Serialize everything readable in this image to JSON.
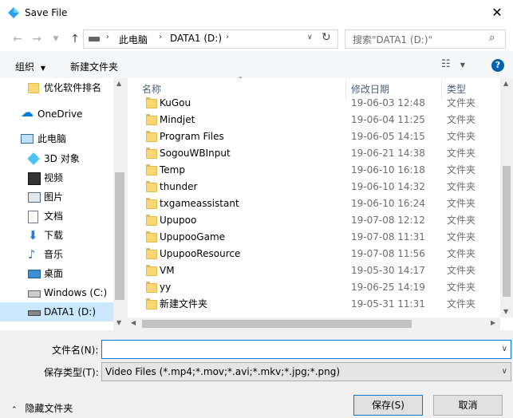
{
  "window": {
    "title": "Save File"
  },
  "address": {
    "path": [
      "此电脑",
      "DATA1 (D:)"
    ],
    "search_placeholder": "搜索\"DATA1 (D:)\""
  },
  "toolbar": {
    "organize": "组织",
    "new_folder": "新建文件夹"
  },
  "sidebar": {
    "items": [
      {
        "label": "优化软件排名",
        "icon": "folder-icon"
      },
      {
        "label": "OneDrive",
        "icon": "cloud-icon"
      },
      {
        "label": "此电脑",
        "icon": "computer-icon"
      },
      {
        "label": "3D 对象",
        "icon": "cube-icon"
      },
      {
        "label": "视频",
        "icon": "video-icon"
      },
      {
        "label": "图片",
        "icon": "picture-icon"
      },
      {
        "label": "文档",
        "icon": "document-icon"
      },
      {
        "label": "下载",
        "icon": "download-icon"
      },
      {
        "label": "音乐",
        "icon": "music-icon"
      },
      {
        "label": "桌面",
        "icon": "desktop-icon"
      },
      {
        "label": "Windows (C:)",
        "icon": "drive-c-icon"
      },
      {
        "label": "DATA1 (D:)",
        "icon": "drive-d-icon",
        "selected": true
      }
    ]
  },
  "columns": {
    "name": "名称",
    "date": "修改日期",
    "type": "类型"
  },
  "files": [
    {
      "name": "KuGou",
      "date": "19-06-03 12:48",
      "type": "文件夹"
    },
    {
      "name": "Mindjet",
      "date": "19-06-04 11:25",
      "type": "文件夹"
    },
    {
      "name": "Program Files",
      "date": "19-06-05 14:15",
      "type": "文件夹"
    },
    {
      "name": "SogouWBInput",
      "date": "19-06-21 14:38",
      "type": "文件夹"
    },
    {
      "name": "Temp",
      "date": "19-06-10 16:18",
      "type": "文件夹"
    },
    {
      "name": "thunder",
      "date": "19-06-10 14:32",
      "type": "文件夹"
    },
    {
      "name": "txgameassistant",
      "date": "19-06-10 16:24",
      "type": "文件夹"
    },
    {
      "name": "Upupoo",
      "date": "19-07-08 12:12",
      "type": "文件夹"
    },
    {
      "name": "UpupooGame",
      "date": "19-07-08 11:31",
      "type": "文件夹"
    },
    {
      "name": "UpupooResource",
      "date": "19-07-08 11:56",
      "type": "文件夹"
    },
    {
      "name": "VM",
      "date": "19-05-30 14:17",
      "type": "文件夹"
    },
    {
      "name": "yy",
      "date": "19-06-25 14:19",
      "type": "文件夹"
    },
    {
      "name": "新建文件夹",
      "date": "19-05-31 11:31",
      "type": "文件夹"
    }
  ],
  "form": {
    "filename_label": "文件名(N):",
    "filename_value": "",
    "filetype_label": "保存类型(T):",
    "filetype_value": "Video Files (*.mp4;*.mov;*.avi;*.mkv;*.jpg;*.png)"
  },
  "footer": {
    "hide_folders": "隐藏文件夹",
    "save": "保存(S)",
    "cancel": "取消"
  },
  "colors": {
    "accent": "#0078d7",
    "selected_bg": "#cce8ff",
    "help": "#0063b1"
  }
}
